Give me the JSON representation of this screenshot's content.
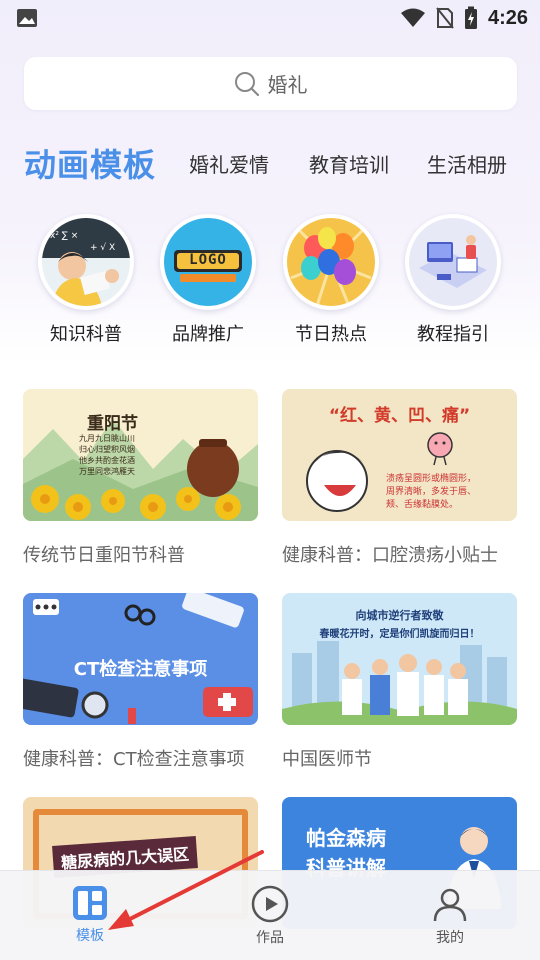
{
  "status_bar": {
    "time": "4:26"
  },
  "search": {
    "text": "婚礼"
  },
  "tabs": {
    "active": "动画模板",
    "items": [
      "婚礼爱情",
      "教育培训",
      "生活相册"
    ]
  },
  "categories": [
    {
      "label": "知识科普"
    },
    {
      "label": "品牌推广",
      "logo_text": "LOGO"
    },
    {
      "label": "节日热点"
    },
    {
      "label": "教程指引"
    }
  ],
  "cards": [
    {
      "title": "传统节日重阳节科普",
      "img_title": "重阳节",
      "img_lines": [
        "九月九日眺山川",
        "归心归望积风烟",
        "他乡共酌金花酒",
        "万里同悲鸿雁天"
      ]
    },
    {
      "title": "健康科普：口腔溃疡小贴士",
      "img_title": "“红、黄、凹、痛”",
      "img_lines": [
        "溃疡呈圆形或椭圆形，",
        "周界清晰，多发于唇、",
        "颊、舌缘黏膜处。"
      ]
    },
    {
      "title": "健康科普：CT检查注意事项",
      "img_title": "CT检查注意事项"
    },
    {
      "title": "中国医师节",
      "img_lines": [
        "向城市逆行者致敬",
        "春暖花开时，定是你们凯旋而归日！"
      ]
    },
    {
      "img_title": "糖尿病的几大误区"
    },
    {
      "img_lines": [
        "帕金森病",
        "科普讲解"
      ]
    }
  ],
  "bottom_nav": [
    {
      "label": "模板",
      "active": true
    },
    {
      "label": "作品"
    },
    {
      "label": "我的"
    }
  ],
  "colors": {
    "accent": "#4a8fe8",
    "annotation_arrow": "#e53935"
  }
}
